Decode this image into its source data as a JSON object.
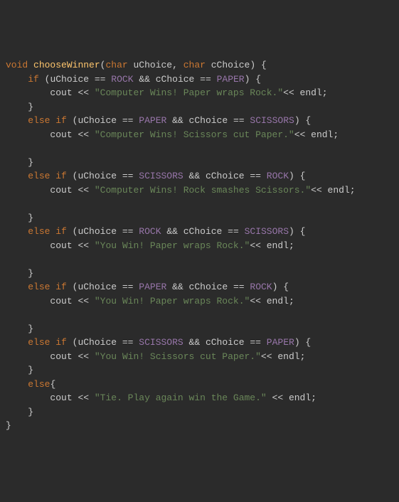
{
  "code": {
    "lines": [
      {
        "indent": 0,
        "tokens": [
          {
            "t": "kw",
            "v": "void"
          },
          {
            "t": "sp",
            "v": " "
          },
          {
            "t": "fn",
            "v": "chooseWinner"
          },
          {
            "t": "punct",
            "v": "("
          },
          {
            "t": "type",
            "v": "char"
          },
          {
            "t": "sp",
            "v": " "
          },
          {
            "t": "param",
            "v": "uChoice"
          },
          {
            "t": "punct",
            "v": ", "
          },
          {
            "t": "type",
            "v": "char"
          },
          {
            "t": "sp",
            "v": " "
          },
          {
            "t": "param",
            "v": "cChoice"
          },
          {
            "t": "punct",
            "v": ") {"
          }
        ]
      },
      {
        "indent": 1,
        "tokens": [
          {
            "t": "kw",
            "v": "if"
          },
          {
            "t": "sp",
            "v": " "
          },
          {
            "t": "punct",
            "v": "("
          },
          {
            "t": "param",
            "v": "uChoice"
          },
          {
            "t": "sp",
            "v": " "
          },
          {
            "t": "op",
            "v": "=="
          },
          {
            "t": "sp",
            "v": " "
          },
          {
            "t": "const",
            "v": "ROCK"
          },
          {
            "t": "sp",
            "v": " "
          },
          {
            "t": "op",
            "v": "&&"
          },
          {
            "t": "sp",
            "v": " "
          },
          {
            "t": "param",
            "v": "cChoice"
          },
          {
            "t": "sp",
            "v": " "
          },
          {
            "t": "op",
            "v": "=="
          },
          {
            "t": "sp",
            "v": " "
          },
          {
            "t": "const",
            "v": "PAPER"
          },
          {
            "t": "punct",
            "v": ") {"
          }
        ]
      },
      {
        "indent": 2,
        "tokens": [
          {
            "t": "param",
            "v": "cout"
          },
          {
            "t": "sp",
            "v": " "
          },
          {
            "t": "op",
            "v": "<<"
          },
          {
            "t": "sp",
            "v": " "
          },
          {
            "t": "str",
            "v": "\"Computer Wins! Paper wraps Rock.\""
          },
          {
            "t": "op",
            "v": "<<"
          },
          {
            "t": "sp",
            "v": " "
          },
          {
            "t": "param",
            "v": "endl"
          },
          {
            "t": "punct",
            "v": ";"
          }
        ]
      },
      {
        "indent": 1,
        "tokens": [
          {
            "t": "punct",
            "v": "}"
          }
        ]
      },
      {
        "indent": 1,
        "tokens": [
          {
            "t": "kw",
            "v": "else if"
          },
          {
            "t": "sp",
            "v": " "
          },
          {
            "t": "punct",
            "v": "("
          },
          {
            "t": "param",
            "v": "uChoice"
          },
          {
            "t": "sp",
            "v": " "
          },
          {
            "t": "op",
            "v": "=="
          },
          {
            "t": "sp",
            "v": " "
          },
          {
            "t": "const",
            "v": "PAPER"
          },
          {
            "t": "sp",
            "v": " "
          },
          {
            "t": "op",
            "v": "&&"
          },
          {
            "t": "sp",
            "v": " "
          },
          {
            "t": "param",
            "v": "cChoice"
          },
          {
            "t": "sp",
            "v": " "
          },
          {
            "t": "op",
            "v": "=="
          },
          {
            "t": "sp",
            "v": " "
          },
          {
            "t": "const",
            "v": "SCISSORS"
          },
          {
            "t": "punct",
            "v": ") {"
          }
        ]
      },
      {
        "indent": 2,
        "tokens": [
          {
            "t": "param",
            "v": "cout"
          },
          {
            "t": "sp",
            "v": " "
          },
          {
            "t": "op",
            "v": "<<"
          },
          {
            "t": "sp",
            "v": " "
          },
          {
            "t": "str",
            "v": "\"Computer Wins! Scissors cut Paper.\""
          },
          {
            "t": "op",
            "v": "<<"
          },
          {
            "t": "sp",
            "v": " "
          },
          {
            "t": "param",
            "v": "endl"
          },
          {
            "t": "punct",
            "v": ";"
          }
        ]
      },
      {
        "indent": 0,
        "tokens": []
      },
      {
        "indent": 1,
        "tokens": [
          {
            "t": "punct",
            "v": "}"
          }
        ]
      },
      {
        "indent": 1,
        "tokens": [
          {
            "t": "kw",
            "v": "else if"
          },
          {
            "t": "sp",
            "v": " "
          },
          {
            "t": "punct",
            "v": "("
          },
          {
            "t": "param",
            "v": "uChoice"
          },
          {
            "t": "sp",
            "v": " "
          },
          {
            "t": "op",
            "v": "=="
          },
          {
            "t": "sp",
            "v": " "
          },
          {
            "t": "const",
            "v": "SCISSORS"
          },
          {
            "t": "sp",
            "v": " "
          },
          {
            "t": "op",
            "v": "&&"
          },
          {
            "t": "sp",
            "v": " "
          },
          {
            "t": "param",
            "v": "cChoice"
          },
          {
            "t": "sp",
            "v": " "
          },
          {
            "t": "op",
            "v": "=="
          },
          {
            "t": "sp",
            "v": " "
          },
          {
            "t": "const",
            "v": "ROCK"
          },
          {
            "t": "punct",
            "v": ") {"
          }
        ]
      },
      {
        "indent": 2,
        "tokens": [
          {
            "t": "param",
            "v": "cout"
          },
          {
            "t": "sp",
            "v": " "
          },
          {
            "t": "op",
            "v": "<<"
          },
          {
            "t": "sp",
            "v": " "
          },
          {
            "t": "str",
            "v": "\"Computer Wins! Rock smashes Scissors.\""
          },
          {
            "t": "op",
            "v": "<<"
          },
          {
            "t": "sp",
            "v": " "
          },
          {
            "t": "param",
            "v": "endl"
          },
          {
            "t": "punct",
            "v": ";"
          }
        ]
      },
      {
        "indent": 0,
        "tokens": []
      },
      {
        "indent": 1,
        "tokens": [
          {
            "t": "punct",
            "v": "}"
          }
        ]
      },
      {
        "indent": 1,
        "tokens": [
          {
            "t": "kw",
            "v": "else if"
          },
          {
            "t": "sp",
            "v": " "
          },
          {
            "t": "punct",
            "v": "("
          },
          {
            "t": "param",
            "v": "uChoice"
          },
          {
            "t": "sp",
            "v": " "
          },
          {
            "t": "op",
            "v": "=="
          },
          {
            "t": "sp",
            "v": " "
          },
          {
            "t": "const",
            "v": "ROCK"
          },
          {
            "t": "sp",
            "v": " "
          },
          {
            "t": "op",
            "v": "&&"
          },
          {
            "t": "sp",
            "v": " "
          },
          {
            "t": "param",
            "v": "cChoice"
          },
          {
            "t": "sp",
            "v": " "
          },
          {
            "t": "op",
            "v": "=="
          },
          {
            "t": "sp",
            "v": " "
          },
          {
            "t": "const",
            "v": "SCISSORS"
          },
          {
            "t": "punct",
            "v": ") {"
          }
        ]
      },
      {
        "indent": 2,
        "tokens": [
          {
            "t": "param",
            "v": "cout"
          },
          {
            "t": "sp",
            "v": " "
          },
          {
            "t": "op",
            "v": "<<"
          },
          {
            "t": "sp",
            "v": " "
          },
          {
            "t": "str",
            "v": "\"You Win! Paper wraps Rock.\""
          },
          {
            "t": "op",
            "v": "<<"
          },
          {
            "t": "sp",
            "v": " "
          },
          {
            "t": "param",
            "v": "endl"
          },
          {
            "t": "punct",
            "v": ";"
          }
        ]
      },
      {
        "indent": 0,
        "tokens": []
      },
      {
        "indent": 1,
        "tokens": [
          {
            "t": "punct",
            "v": "}"
          }
        ]
      },
      {
        "indent": 1,
        "tokens": [
          {
            "t": "kw",
            "v": "else if"
          },
          {
            "t": "sp",
            "v": " "
          },
          {
            "t": "punct",
            "v": "("
          },
          {
            "t": "param",
            "v": "uChoice"
          },
          {
            "t": "sp",
            "v": " "
          },
          {
            "t": "op",
            "v": "=="
          },
          {
            "t": "sp",
            "v": " "
          },
          {
            "t": "const",
            "v": "PAPER"
          },
          {
            "t": "sp",
            "v": " "
          },
          {
            "t": "op",
            "v": "&&"
          },
          {
            "t": "sp",
            "v": " "
          },
          {
            "t": "param",
            "v": "cChoice"
          },
          {
            "t": "sp",
            "v": " "
          },
          {
            "t": "op",
            "v": "=="
          },
          {
            "t": "sp",
            "v": " "
          },
          {
            "t": "const",
            "v": "ROCK"
          },
          {
            "t": "punct",
            "v": ") {"
          }
        ]
      },
      {
        "indent": 2,
        "tokens": [
          {
            "t": "param",
            "v": "cout"
          },
          {
            "t": "sp",
            "v": " "
          },
          {
            "t": "op",
            "v": "<<"
          },
          {
            "t": "sp",
            "v": " "
          },
          {
            "t": "str",
            "v": "\"You Win! Paper wraps Rock.\""
          },
          {
            "t": "op",
            "v": "<<"
          },
          {
            "t": "sp",
            "v": " "
          },
          {
            "t": "param",
            "v": "endl"
          },
          {
            "t": "punct",
            "v": ";"
          }
        ]
      },
      {
        "indent": 0,
        "tokens": []
      },
      {
        "indent": 1,
        "tokens": [
          {
            "t": "punct",
            "v": "}"
          }
        ]
      },
      {
        "indent": 1,
        "tokens": [
          {
            "t": "kw",
            "v": "else if"
          },
          {
            "t": "sp",
            "v": " "
          },
          {
            "t": "punct",
            "v": "("
          },
          {
            "t": "param",
            "v": "uChoice"
          },
          {
            "t": "sp",
            "v": " "
          },
          {
            "t": "op",
            "v": "=="
          },
          {
            "t": "sp",
            "v": " "
          },
          {
            "t": "const",
            "v": "SCISSORS"
          },
          {
            "t": "sp",
            "v": " "
          },
          {
            "t": "op",
            "v": "&&"
          },
          {
            "t": "sp",
            "v": " "
          },
          {
            "t": "param",
            "v": "cChoice"
          },
          {
            "t": "sp",
            "v": " "
          },
          {
            "t": "op",
            "v": "=="
          },
          {
            "t": "sp",
            "v": " "
          },
          {
            "t": "const",
            "v": "PAPER"
          },
          {
            "t": "punct",
            "v": ") {"
          }
        ]
      },
      {
        "indent": 2,
        "tokens": [
          {
            "t": "param",
            "v": "cout"
          },
          {
            "t": "sp",
            "v": " "
          },
          {
            "t": "op",
            "v": "<<"
          },
          {
            "t": "sp",
            "v": " "
          },
          {
            "t": "str",
            "v": "\"You Win! Scissors cut Paper.\""
          },
          {
            "t": "op",
            "v": "<<"
          },
          {
            "t": "sp",
            "v": " "
          },
          {
            "t": "param",
            "v": "endl"
          },
          {
            "t": "punct",
            "v": ";"
          }
        ]
      },
      {
        "indent": 1,
        "tokens": [
          {
            "t": "punct",
            "v": "}"
          }
        ]
      },
      {
        "indent": 1,
        "tokens": [
          {
            "t": "kw",
            "v": "else"
          },
          {
            "t": "punct",
            "v": "{"
          }
        ]
      },
      {
        "indent": 2,
        "tokens": [
          {
            "t": "param",
            "v": "cout"
          },
          {
            "t": "sp",
            "v": " "
          },
          {
            "t": "op",
            "v": "<<"
          },
          {
            "t": "sp",
            "v": " "
          },
          {
            "t": "str",
            "v": "\"Tie. Play again win the Game.\""
          },
          {
            "t": "sp",
            "v": " "
          },
          {
            "t": "op",
            "v": "<<"
          },
          {
            "t": "sp",
            "v": " "
          },
          {
            "t": "param",
            "v": "endl"
          },
          {
            "t": "punct",
            "v": ";"
          }
        ]
      },
      {
        "indent": 1,
        "tokens": [
          {
            "t": "punct",
            "v": "}"
          }
        ]
      },
      {
        "indent": 0,
        "tokens": [
          {
            "t": "punct",
            "v": "}"
          }
        ]
      }
    ]
  }
}
